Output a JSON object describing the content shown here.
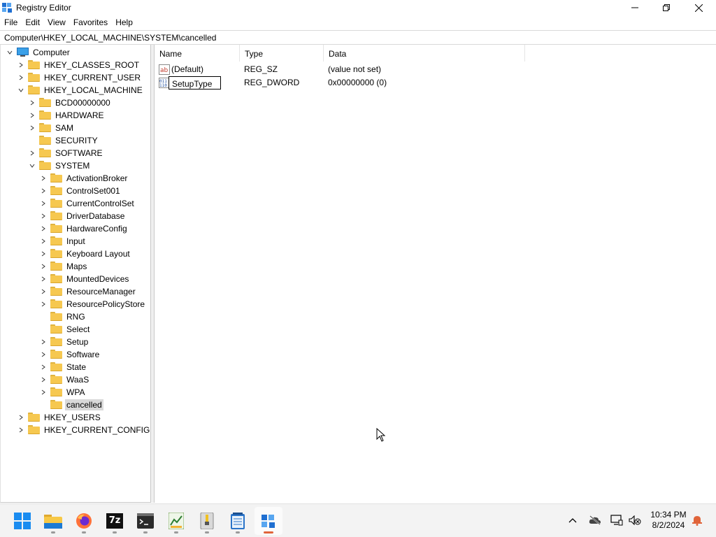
{
  "window": {
    "title": "Registry Editor",
    "controls": {
      "minimize": "minimize",
      "maximize": "restore",
      "close": "close"
    }
  },
  "menu": [
    "File",
    "Edit",
    "View",
    "Favorites",
    "Help"
  ],
  "address": "Computer\\HKEY_LOCAL_MACHINE\\SYSTEM\\cancelled",
  "tree": [
    {
      "label": "Computer",
      "level": 0,
      "state": "expanded",
      "icon": "computer-icon"
    },
    {
      "label": "HKEY_CLASSES_ROOT",
      "level": 1,
      "state": "collapsed",
      "icon": "folder-icon"
    },
    {
      "label": "HKEY_CURRENT_USER",
      "level": 1,
      "state": "collapsed",
      "icon": "folder-icon"
    },
    {
      "label": "HKEY_LOCAL_MACHINE",
      "level": 1,
      "state": "expanded",
      "icon": "folder-icon"
    },
    {
      "label": "BCD00000000",
      "level": 2,
      "state": "collapsed",
      "icon": "folder-icon"
    },
    {
      "label": "HARDWARE",
      "level": 2,
      "state": "collapsed",
      "icon": "folder-icon"
    },
    {
      "label": "SAM",
      "level": 2,
      "state": "collapsed",
      "icon": "folder-icon"
    },
    {
      "label": "SECURITY",
      "level": 2,
      "state": "leaf",
      "icon": "folder-icon"
    },
    {
      "label": "SOFTWARE",
      "level": 2,
      "state": "collapsed",
      "icon": "folder-icon"
    },
    {
      "label": "SYSTEM",
      "level": 2,
      "state": "expanded",
      "icon": "folder-icon"
    },
    {
      "label": "ActivationBroker",
      "level": 3,
      "state": "collapsed",
      "icon": "folder-icon"
    },
    {
      "label": "ControlSet001",
      "level": 3,
      "state": "collapsed",
      "icon": "folder-icon"
    },
    {
      "label": "CurrentControlSet",
      "level": 3,
      "state": "collapsed",
      "icon": "folder-icon"
    },
    {
      "label": "DriverDatabase",
      "level": 3,
      "state": "collapsed",
      "icon": "folder-icon"
    },
    {
      "label": "HardwareConfig",
      "level": 3,
      "state": "collapsed",
      "icon": "folder-icon"
    },
    {
      "label": "Input",
      "level": 3,
      "state": "collapsed",
      "icon": "folder-icon"
    },
    {
      "label": "Keyboard Layout",
      "level": 3,
      "state": "collapsed",
      "icon": "folder-icon"
    },
    {
      "label": "Maps",
      "level": 3,
      "state": "collapsed",
      "icon": "folder-icon"
    },
    {
      "label": "MountedDevices",
      "level": 3,
      "state": "collapsed",
      "icon": "folder-icon"
    },
    {
      "label": "ResourceManager",
      "level": 3,
      "state": "collapsed",
      "icon": "folder-icon"
    },
    {
      "label": "ResourcePolicyStore",
      "level": 3,
      "state": "collapsed",
      "icon": "folder-icon"
    },
    {
      "label": "RNG",
      "level": 3,
      "state": "leaf",
      "icon": "folder-icon"
    },
    {
      "label": "Select",
      "level": 3,
      "state": "leaf",
      "icon": "folder-icon"
    },
    {
      "label": "Setup",
      "level": 3,
      "state": "collapsed",
      "icon": "folder-icon"
    },
    {
      "label": "Software",
      "level": 3,
      "state": "collapsed",
      "icon": "folder-icon"
    },
    {
      "label": "State",
      "level": 3,
      "state": "collapsed",
      "icon": "folder-icon"
    },
    {
      "label": "WaaS",
      "level": 3,
      "state": "collapsed",
      "icon": "folder-icon"
    },
    {
      "label": "WPA",
      "level": 3,
      "state": "collapsed",
      "icon": "folder-icon"
    },
    {
      "label": "cancelled",
      "level": 3,
      "state": "leaf",
      "icon": "folder-icon",
      "selected": true
    },
    {
      "label": "HKEY_USERS",
      "level": 1,
      "state": "collapsed",
      "icon": "folder-icon"
    },
    {
      "label": "HKEY_CURRENT_CONFIG",
      "level": 1,
      "state": "collapsed",
      "icon": "folder-icon"
    }
  ],
  "columns": {
    "name": "Name",
    "type": "Type",
    "data": "Data"
  },
  "values": [
    {
      "name": "(Default)",
      "type": "REG_SZ",
      "data": "(value not set)",
      "icon": "string-value-icon",
      "editing": false
    },
    {
      "name": "SetupType",
      "type": "REG_DWORD",
      "data": "0x00000000 (0)",
      "icon": "binary-value-icon",
      "editing": true
    }
  ],
  "taskbar": {
    "apps": [
      {
        "name": "start-button",
        "icon": "windows-logo-icon"
      },
      {
        "name": "file-explorer",
        "icon": "folder-icon"
      },
      {
        "name": "firefox",
        "icon": "firefox-icon"
      },
      {
        "name": "7-zip",
        "icon": "7zip-icon",
        "text": "7z"
      },
      {
        "name": "terminal",
        "icon": "terminal-icon"
      },
      {
        "name": "chart-app",
        "icon": "chart-icon"
      },
      {
        "name": "archive-app",
        "icon": "archive-icon"
      },
      {
        "name": "notepad",
        "icon": "notepad-icon"
      },
      {
        "name": "registry-editor",
        "icon": "registry-icon",
        "active": true
      }
    ],
    "tray": [
      "chevron-up-icon",
      "onedrive-offline-icon",
      "network-icon",
      "volume-muted-icon"
    ],
    "time": "10:34 PM",
    "date": "8/2/2024",
    "notification_icon": "bell-icon"
  },
  "colors": {
    "folder": "#f6c850",
    "selection": "#d9d9d9",
    "accent": "#0067c0",
    "active_indicator": "#e0643a"
  }
}
